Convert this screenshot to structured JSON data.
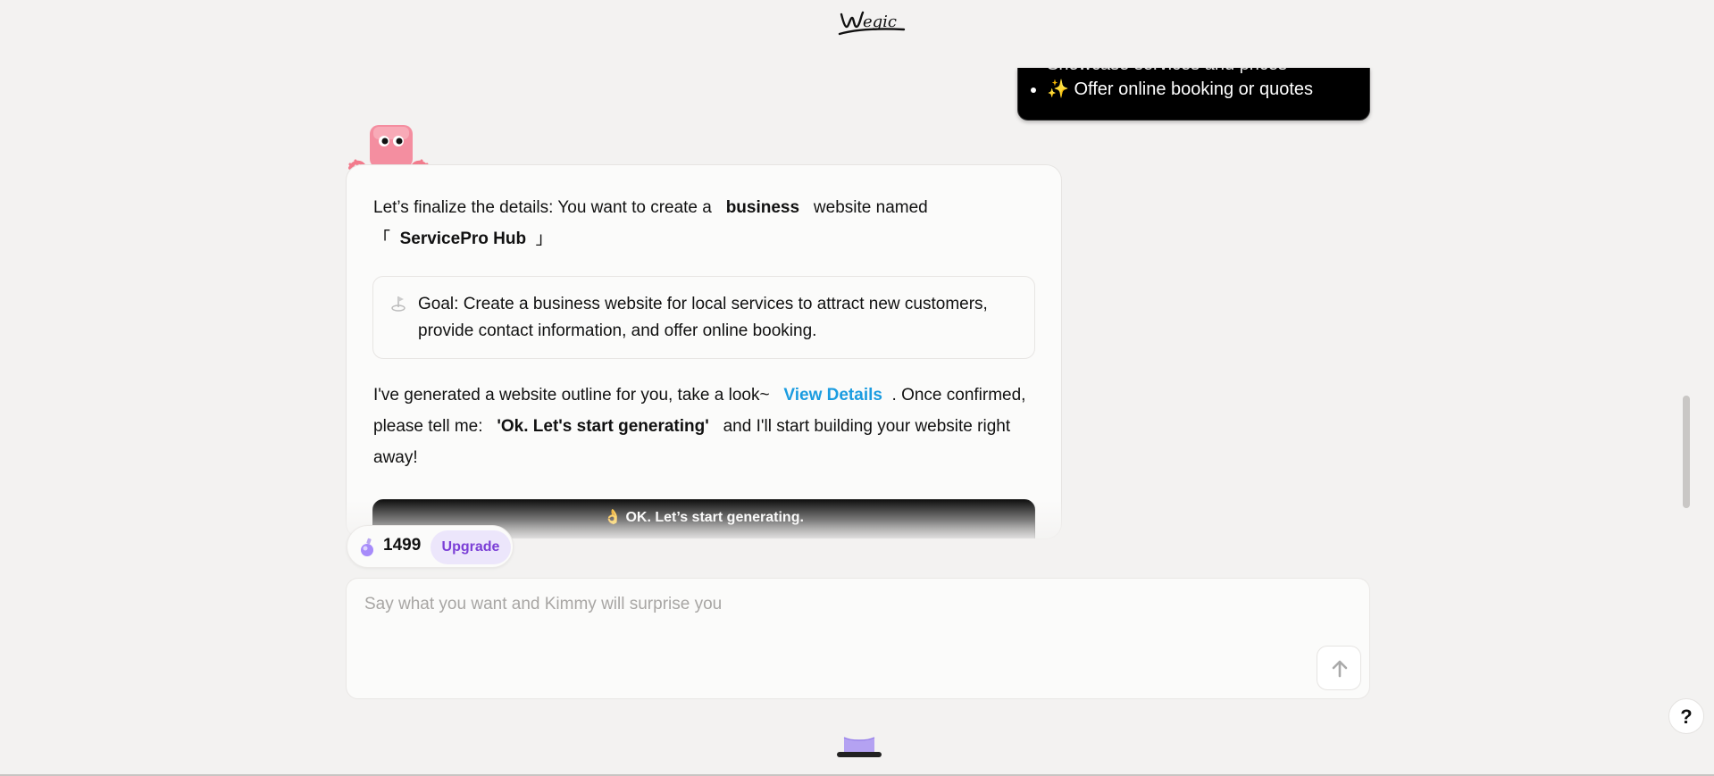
{
  "logo": {
    "text": "wegic"
  },
  "user_message": {
    "items": [
      "Showcase services and prices",
      "✨ Offer online booking or quotes"
    ]
  },
  "ai_message": {
    "intro_prefix": "Let’s finalize the details: You want to create a",
    "site_type": "business",
    "intro_mid": "website named",
    "bracket_open": "「",
    "site_name": "ServicePro Hub",
    "bracket_close": "」",
    "goal": "Goal: Create a business website for local services to attract new customers, provide contact information, and offer online booking.",
    "outline_prefix": "I've generated a website outline for you, take a look~",
    "view_details": "View Details",
    "outline_mid": ". Once confirmed, please tell me:",
    "confirm_phrase": "'Ok. Let's start generating'",
    "outline_suffix": "and I'll start building your website right away!",
    "start_button": "👌 OK. Let’s start generating."
  },
  "credits": {
    "count": "1499",
    "upgrade_label": "Upgrade"
  },
  "composer": {
    "placeholder": "Say what you want and Kimmy will surprise you"
  },
  "help": {
    "label": "?"
  },
  "colors": {
    "background": "#f3f2f1",
    "link": "#1b9ce0",
    "upgrade": "#7b3fd6"
  }
}
